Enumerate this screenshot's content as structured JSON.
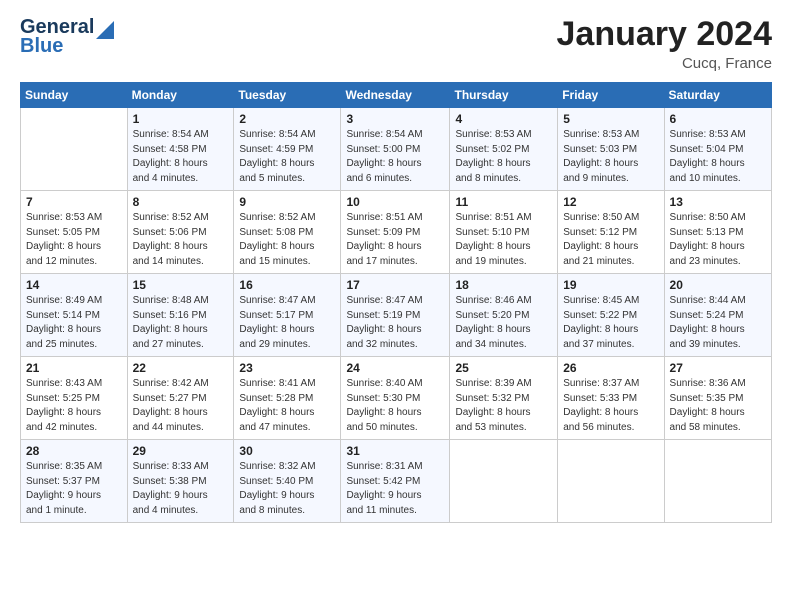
{
  "header": {
    "logo_line1": "General",
    "logo_line2": "Blue",
    "month_title": "January 2024",
    "location": "Cucq, France"
  },
  "days_of_week": [
    "Sunday",
    "Monday",
    "Tuesday",
    "Wednesday",
    "Thursday",
    "Friday",
    "Saturday"
  ],
  "weeks": [
    [
      {
        "num": "",
        "detail": ""
      },
      {
        "num": "1",
        "detail": "Sunrise: 8:54 AM\nSunset: 4:58 PM\nDaylight: 8 hours\nand 4 minutes."
      },
      {
        "num": "2",
        "detail": "Sunrise: 8:54 AM\nSunset: 4:59 PM\nDaylight: 8 hours\nand 5 minutes."
      },
      {
        "num": "3",
        "detail": "Sunrise: 8:54 AM\nSunset: 5:00 PM\nDaylight: 8 hours\nand 6 minutes."
      },
      {
        "num": "4",
        "detail": "Sunrise: 8:53 AM\nSunset: 5:02 PM\nDaylight: 8 hours\nand 8 minutes."
      },
      {
        "num": "5",
        "detail": "Sunrise: 8:53 AM\nSunset: 5:03 PM\nDaylight: 8 hours\nand 9 minutes."
      },
      {
        "num": "6",
        "detail": "Sunrise: 8:53 AM\nSunset: 5:04 PM\nDaylight: 8 hours\nand 10 minutes."
      }
    ],
    [
      {
        "num": "7",
        "detail": "Sunrise: 8:53 AM\nSunset: 5:05 PM\nDaylight: 8 hours\nand 12 minutes."
      },
      {
        "num": "8",
        "detail": "Sunrise: 8:52 AM\nSunset: 5:06 PM\nDaylight: 8 hours\nand 14 minutes."
      },
      {
        "num": "9",
        "detail": "Sunrise: 8:52 AM\nSunset: 5:08 PM\nDaylight: 8 hours\nand 15 minutes."
      },
      {
        "num": "10",
        "detail": "Sunrise: 8:51 AM\nSunset: 5:09 PM\nDaylight: 8 hours\nand 17 minutes."
      },
      {
        "num": "11",
        "detail": "Sunrise: 8:51 AM\nSunset: 5:10 PM\nDaylight: 8 hours\nand 19 minutes."
      },
      {
        "num": "12",
        "detail": "Sunrise: 8:50 AM\nSunset: 5:12 PM\nDaylight: 8 hours\nand 21 minutes."
      },
      {
        "num": "13",
        "detail": "Sunrise: 8:50 AM\nSunset: 5:13 PM\nDaylight: 8 hours\nand 23 minutes."
      }
    ],
    [
      {
        "num": "14",
        "detail": "Sunrise: 8:49 AM\nSunset: 5:14 PM\nDaylight: 8 hours\nand 25 minutes."
      },
      {
        "num": "15",
        "detail": "Sunrise: 8:48 AM\nSunset: 5:16 PM\nDaylight: 8 hours\nand 27 minutes."
      },
      {
        "num": "16",
        "detail": "Sunrise: 8:47 AM\nSunset: 5:17 PM\nDaylight: 8 hours\nand 29 minutes."
      },
      {
        "num": "17",
        "detail": "Sunrise: 8:47 AM\nSunset: 5:19 PM\nDaylight: 8 hours\nand 32 minutes."
      },
      {
        "num": "18",
        "detail": "Sunrise: 8:46 AM\nSunset: 5:20 PM\nDaylight: 8 hours\nand 34 minutes."
      },
      {
        "num": "19",
        "detail": "Sunrise: 8:45 AM\nSunset: 5:22 PM\nDaylight: 8 hours\nand 37 minutes."
      },
      {
        "num": "20",
        "detail": "Sunrise: 8:44 AM\nSunset: 5:24 PM\nDaylight: 8 hours\nand 39 minutes."
      }
    ],
    [
      {
        "num": "21",
        "detail": "Sunrise: 8:43 AM\nSunset: 5:25 PM\nDaylight: 8 hours\nand 42 minutes."
      },
      {
        "num": "22",
        "detail": "Sunrise: 8:42 AM\nSunset: 5:27 PM\nDaylight: 8 hours\nand 44 minutes."
      },
      {
        "num": "23",
        "detail": "Sunrise: 8:41 AM\nSunset: 5:28 PM\nDaylight: 8 hours\nand 47 minutes."
      },
      {
        "num": "24",
        "detail": "Sunrise: 8:40 AM\nSunset: 5:30 PM\nDaylight: 8 hours\nand 50 minutes."
      },
      {
        "num": "25",
        "detail": "Sunrise: 8:39 AM\nSunset: 5:32 PM\nDaylight: 8 hours\nand 53 minutes."
      },
      {
        "num": "26",
        "detail": "Sunrise: 8:37 AM\nSunset: 5:33 PM\nDaylight: 8 hours\nand 56 minutes."
      },
      {
        "num": "27",
        "detail": "Sunrise: 8:36 AM\nSunset: 5:35 PM\nDaylight: 8 hours\nand 58 minutes."
      }
    ],
    [
      {
        "num": "28",
        "detail": "Sunrise: 8:35 AM\nSunset: 5:37 PM\nDaylight: 9 hours\nand 1 minute."
      },
      {
        "num": "29",
        "detail": "Sunrise: 8:33 AM\nSunset: 5:38 PM\nDaylight: 9 hours\nand 4 minutes."
      },
      {
        "num": "30",
        "detail": "Sunrise: 8:32 AM\nSunset: 5:40 PM\nDaylight: 9 hours\nand 8 minutes."
      },
      {
        "num": "31",
        "detail": "Sunrise: 8:31 AM\nSunset: 5:42 PM\nDaylight: 9 hours\nand 11 minutes."
      },
      {
        "num": "",
        "detail": ""
      },
      {
        "num": "",
        "detail": ""
      },
      {
        "num": "",
        "detail": ""
      }
    ]
  ]
}
